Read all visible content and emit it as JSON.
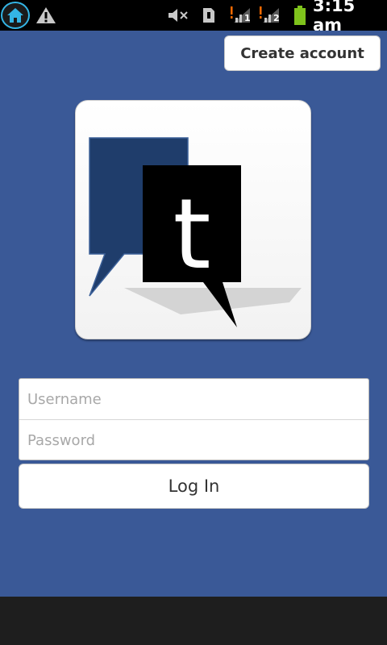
{
  "status_bar": {
    "time": "3:15 am",
    "icons": [
      "home-icon",
      "warning-icon",
      "mute-icon",
      "sim-icon",
      "signal-1-icon",
      "signal-2-icon",
      "battery-icon"
    ],
    "signal_1_label": "1",
    "signal_2_label": "2",
    "colors": {
      "background": "#000000",
      "home_ring": "#34b5e5",
      "battery": "#7fc31c",
      "alert": "#ff6a00"
    }
  },
  "header": {
    "create_account_label": "Create account"
  },
  "logo": {
    "icon": "t-speech-bubbles-logo",
    "letter": "t"
  },
  "login": {
    "username_placeholder": "Username",
    "password_placeholder": "Password",
    "login_label": "Log In"
  },
  "colors": {
    "app_background": "#3a5997",
    "button_background": "#ffffff",
    "navigation_bar": "#1e1e1e"
  }
}
